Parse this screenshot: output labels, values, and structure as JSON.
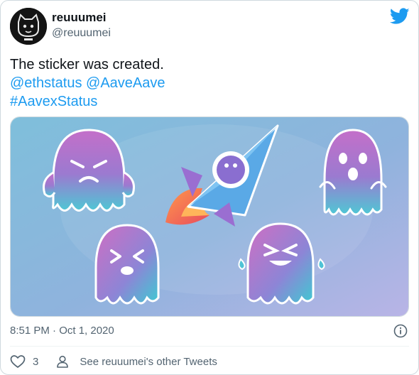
{
  "user": {
    "display_name": "reuuumei",
    "handle": "@reuuumei"
  },
  "tweet": {
    "text_line1": "The sticker was created.",
    "mention1": "@ethstatus",
    "mention2": "@AaveAave",
    "hashtag": "#AavexStatus",
    "timestamp": "8:51 PM · Oct 1, 2020"
  },
  "actions": {
    "like_count": "3",
    "other_tweets_label": "See reuuumei's other Tweets"
  },
  "colors": {
    "link": "#1d9bf0",
    "muted": "#536471",
    "ghost_pink": "#b86fc7",
    "ghost_teal": "#4fc3d6",
    "rocket_blue": "#5aa9e6"
  },
  "icons": [
    "twitter-bird-icon",
    "info-icon",
    "heart-icon",
    "person-icon"
  ]
}
